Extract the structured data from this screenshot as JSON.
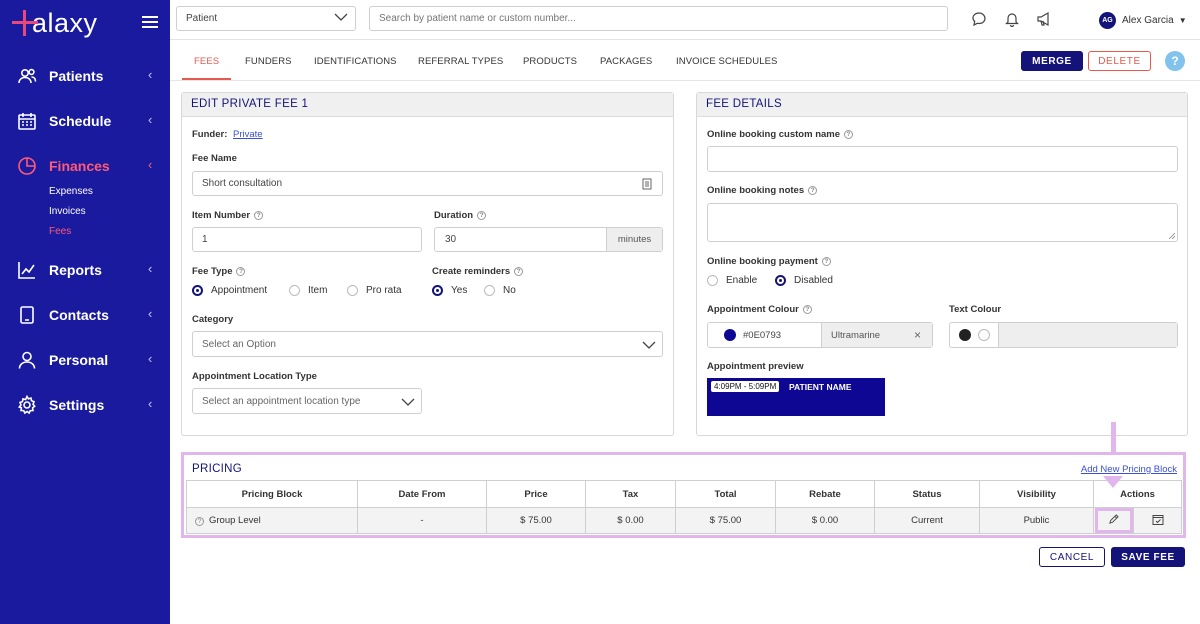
{
  "app": {
    "logo_text": "alaxy"
  },
  "sidebar": {
    "items": [
      {
        "label": "Patients",
        "icon": "users-icon"
      },
      {
        "label": "Schedule",
        "icon": "calendar-icon"
      },
      {
        "label": "Finances",
        "icon": "pie-chart-icon"
      },
      {
        "label": "Reports",
        "icon": "line-chart-icon"
      },
      {
        "label": "Contacts",
        "icon": "phone-book-icon"
      },
      {
        "label": "Personal",
        "icon": "person-icon"
      },
      {
        "label": "Settings",
        "icon": "gear-icon"
      }
    ],
    "finances_sub": [
      "Expenses",
      "Invoices",
      "Fees"
    ],
    "active_item": "Finances",
    "active_sub": "Fees",
    "colors": {
      "bg": "#1a1a9e",
      "active": "#ff5a78"
    }
  },
  "topbar": {
    "search_type": "Patient",
    "search_placeholder": "Search by patient name or custom number...",
    "user_initials": "AG",
    "user_name": "Alex Garcia"
  },
  "tabs": {
    "items": [
      "FEES",
      "FUNDERS",
      "IDENTIFICATIONS",
      "REFERRAL TYPES",
      "PRODUCTS",
      "PACKAGES",
      "INVOICE SCHEDULES"
    ],
    "active": "FEES",
    "merge_label": "MERGE",
    "delete_label": "DELETE",
    "help_label": "?"
  },
  "edit_fee": {
    "title": "EDIT PRIVATE FEE 1",
    "funder_label": "Funder:",
    "funder_value": "Private",
    "fee_name_label": "Fee Name",
    "fee_name_value": "Short consultation",
    "item_number_label": "Item Number",
    "item_number_value": "1",
    "duration_label": "Duration",
    "duration_value": "30",
    "duration_unit": "minutes",
    "fee_type_label": "Fee Type",
    "fee_type_options": [
      "Appointment",
      "Item",
      "Pro rata"
    ],
    "fee_type_selected": "Appointment",
    "reminders_label": "Create reminders",
    "reminders_options": [
      "Yes",
      "No"
    ],
    "reminders_selected": "Yes",
    "category_label": "Category",
    "category_placeholder": "Select an Option",
    "location_label": "Appointment Location Type",
    "location_placeholder": "Select an appointment location type"
  },
  "fee_details": {
    "title": "FEE DETAILS",
    "custom_name_label": "Online booking custom name",
    "custom_name_value": "",
    "notes_label": "Online booking notes",
    "notes_value": "",
    "payment_label": "Online booking payment",
    "payment_options": [
      "Enable",
      "Disabled"
    ],
    "payment_selected": "Disabled",
    "appt_colour_label": "Appointment Colour",
    "appt_colour_hex": "#0E0793",
    "appt_colour_name": "Ultramarine",
    "text_colour_label": "Text Colour",
    "preview_label": "Appointment preview",
    "preview_time": "4:09PM - 5:09PM",
    "preview_name": "PATIENT NAME"
  },
  "pricing": {
    "title": "PRICING",
    "add_link": "Add New Pricing Block",
    "columns": [
      "Pricing Block",
      "Date From",
      "Price",
      "Tax",
      "Total",
      "Rebate",
      "Status",
      "Visibility",
      "Actions"
    ],
    "rows": [
      {
        "block": "Group Level",
        "date_from": "-",
        "price": "$ 75.00",
        "tax": "$ 0.00",
        "total": "$ 75.00",
        "rebate": "$ 0.00",
        "status": "Current",
        "visibility": "Public"
      }
    ]
  },
  "footer": {
    "cancel_label": "CANCEL",
    "save_label": "SAVE FEE"
  }
}
